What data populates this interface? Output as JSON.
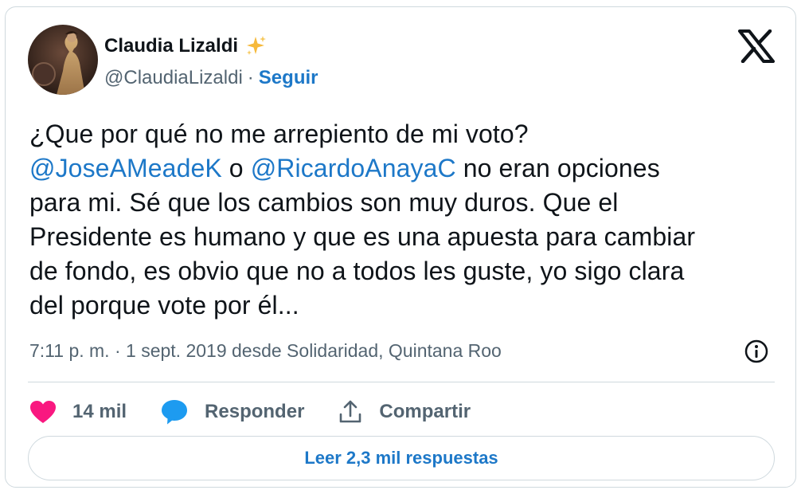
{
  "author": {
    "display_name": "Claudia Lizaldi",
    "handle": "@ClaudiaLizaldi",
    "separator": "·",
    "follow_label": "Seguir",
    "badge_icon": "sparkles-icon"
  },
  "tweet": {
    "line1": "¿Que por qué no me arrepiento de mi voto?",
    "mention1": "@JoseAMeadeK",
    "connector": " o ",
    "mention2": "@RicardoAnayaC",
    "line2_rest": " no eran opciones",
    "line3": "para mi. Sé que los cambios son muy duros. Que el",
    "line4": "Presidente es humano y que es una apuesta para cambiar",
    "line5": "de fondo, es obvio que no a todos les guste, yo sigo clara",
    "line6": "del porque vote por él..."
  },
  "meta": {
    "timestamp": "7:11 p. m. · 1 sept. 2019 desde Solidaridad, Quintana Roo"
  },
  "actions": {
    "likes": "14 mil",
    "reply_label": "Responder",
    "share_label": "Compartir"
  },
  "replies_button_label": "Leer 2,3 mil respuestas",
  "colors": {
    "link": "#1d78c8",
    "like": "#f91880",
    "muted": "#536471",
    "border": "#cfd9de"
  }
}
